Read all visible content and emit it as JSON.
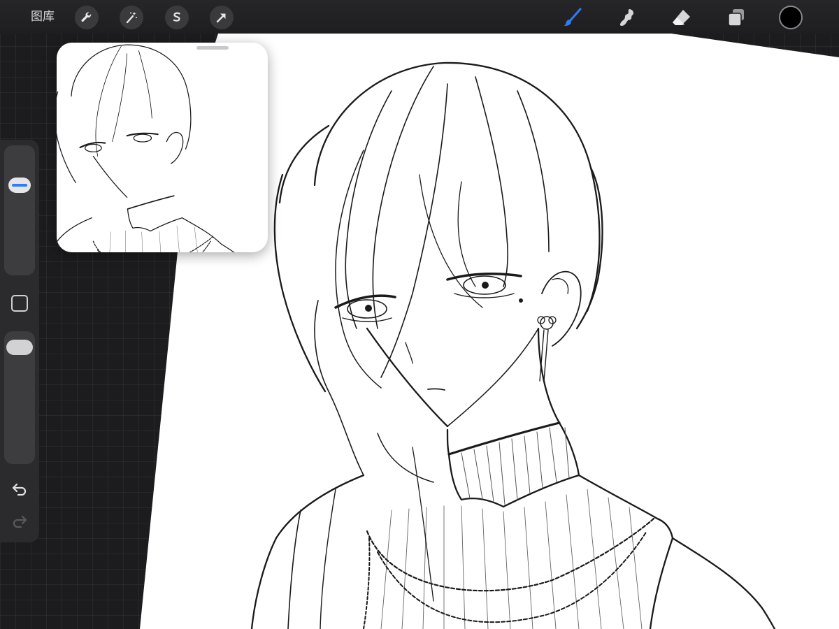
{
  "toolbar": {
    "gallery_label": "图库",
    "action_icons": [
      "wrench-icon",
      "magic-wand-icon",
      "selection-icon",
      "move-arrow-icon"
    ],
    "tool_icons": [
      "brush-icon",
      "smudge-icon",
      "eraser-icon",
      "layers-icon"
    ],
    "active_tool": "brush-icon",
    "current_color": "#000000",
    "accent_color": "#2f7cf6"
  },
  "sidebar": {
    "brush_size_fraction": 0.73,
    "brush_opacity_fraction": 0.95,
    "icons": [
      "modifier-square-icon",
      "undo-icon",
      "redo-icon"
    ]
  },
  "reference_window": {
    "content": "line-art-drawing-thumbnail"
  }
}
